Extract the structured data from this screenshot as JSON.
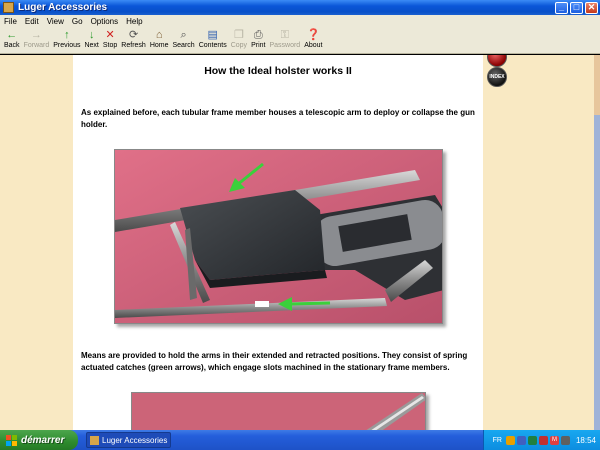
{
  "window": {
    "title": "Luger Accessories"
  },
  "menu": [
    "File",
    "Edit",
    "View",
    "Go",
    "Options",
    "Help"
  ],
  "toolbar": [
    {
      "label": "Back",
      "icon": "←",
      "color": "#2a9a2a",
      "enabled": true
    },
    {
      "label": "Forward",
      "icon": "→",
      "color": "#b8b5a5",
      "enabled": false
    },
    {
      "label": "Previous",
      "icon": "↑",
      "color": "#2a9a2a",
      "enabled": true
    },
    {
      "label": "Next",
      "icon": "↓",
      "color": "#2a9a2a",
      "enabled": true
    },
    {
      "label": "Stop",
      "icon": "✕",
      "color": "#d02020",
      "enabled": true
    },
    {
      "label": "Refresh",
      "icon": "⟳",
      "color": "#555555",
      "enabled": true
    },
    {
      "label": "Home",
      "icon": "⌂",
      "color": "#7a5a30",
      "enabled": true
    },
    {
      "label": "Search",
      "icon": "⌕",
      "color": "#555555",
      "enabled": true
    },
    {
      "label": "Contents",
      "icon": "▤",
      "color": "#3060b0",
      "enabled": true
    },
    {
      "label": "Copy",
      "icon": "❐",
      "color": "#b8b5a5",
      "enabled": false
    },
    {
      "label": "Print",
      "icon": "⎙",
      "color": "#555555",
      "enabled": true
    },
    {
      "label": "Password",
      "icon": "⚿",
      "color": "#b8b5a5",
      "enabled": false
    },
    {
      "label": "About",
      "icon": "❓",
      "color": "#c08020",
      "enabled": true
    }
  ],
  "side_buttons": [
    {
      "label": "",
      "color": "red"
    },
    {
      "label": "INDEX",
      "color": "dark"
    }
  ],
  "article": {
    "heading": "How the Ideal holster works II",
    "para1": "As explained before, each tubular frame member houses a telescopic arm to deploy or collapse the gun holder.",
    "para2": "Means are provided to hold the arms in their extended and retracted positions. They consist of spring actuated catches (green arrows), which engage slots machined in the stationary frame members."
  },
  "taskbar": {
    "start_label": "démarrer",
    "task_label": "Luger Accessories",
    "lang": "FR",
    "clock": "18:54"
  }
}
